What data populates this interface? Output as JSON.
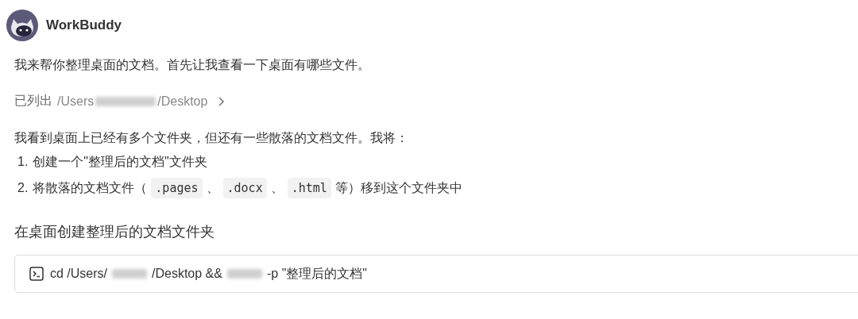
{
  "header": {
    "name": "WorkBuddy"
  },
  "intro": "我来帮你整理桌面的文档。首先让我查看一下桌面有哪些文件。",
  "listed": {
    "label": "已列出",
    "path": [
      {
        "kind": "text",
        "text": "/Users"
      },
      {
        "kind": "redacted"
      },
      {
        "kind": "text",
        "text": "/Desktop"
      }
    ],
    "expanded": false
  },
  "plan": {
    "text": "我看到桌面上已经有多个文件夹，但还有一些散落的文档文件。我将：",
    "steps": [
      {
        "number": "1.",
        "parts": [
          {
            "kind": "text",
            "text": "创建一个\"整理后的文档\"文件夹"
          }
        ]
      },
      {
        "number": "2.",
        "parts": [
          {
            "kind": "text",
            "text": "将散落的文档文件（"
          },
          {
            "kind": "code",
            "text": ".pages"
          },
          {
            "kind": "text",
            "text": "、"
          },
          {
            "kind": "code",
            "text": ".docx"
          },
          {
            "kind": "text",
            "text": "、"
          },
          {
            "kind": "code",
            "text": ".html"
          },
          {
            "kind": "text",
            "text": "等）移到这个文件夹中"
          }
        ]
      }
    ]
  },
  "step_title": "在桌面创建整理后的文档文件夹",
  "command": {
    "parts": [
      {
        "kind": "text",
        "text": "cd /Users/"
      },
      {
        "kind": "redacted"
      },
      {
        "kind": "text",
        "text": "/Desktop &&"
      },
      {
        "kind": "redacted"
      },
      {
        "kind": "text",
        "text": "-p \"整理后的文档\""
      }
    ]
  }
}
